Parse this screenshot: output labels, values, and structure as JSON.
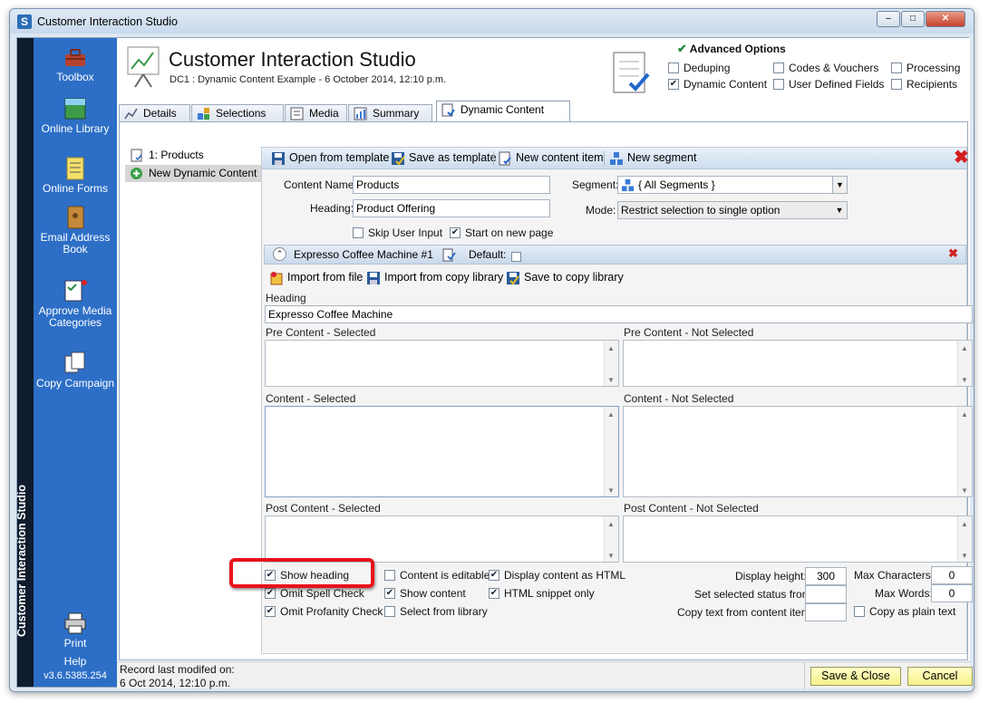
{
  "window": {
    "title": "Customer Interaction Studio",
    "minimize": "–",
    "maximize": "□",
    "close": "✕"
  },
  "sidebar": {
    "vertical_label": "Customer Interaction Studio",
    "items": [
      {
        "label": "Toolbox",
        "icon": "toolbox-icon"
      },
      {
        "label": "Online Library",
        "icon": "online-library-icon"
      },
      {
        "label": "Online Forms",
        "icon": "online-forms-icon"
      },
      {
        "label": "Email Address Book",
        "icon": "address-book-icon"
      },
      {
        "label": "Approve Media Categories",
        "icon": "approve-media-icon"
      },
      {
        "label": "Copy Campaign",
        "icon": "copy-campaign-icon"
      }
    ],
    "print_label": "Print",
    "help_label": "Help",
    "version": "v3.6.5385.254"
  },
  "header": {
    "title": "Customer Interaction Studio",
    "subtitle": "DC1 : Dynamic Content Example - 6 October 2014, 12:10 p.m."
  },
  "advanced": {
    "title": "Advanced Options",
    "options": [
      {
        "label": "Deduping",
        "checked": false
      },
      {
        "label": "Codes & Vouchers",
        "checked": false
      },
      {
        "label": "Processing",
        "checked": false
      },
      {
        "label": "Dynamic Content",
        "checked": true
      },
      {
        "label": "User Defined Fields",
        "checked": false
      },
      {
        "label": "Recipients",
        "checked": false
      }
    ]
  },
  "tabs": [
    {
      "label": "Details"
    },
    {
      "label": "Selections"
    },
    {
      "label": "Media"
    },
    {
      "label": "Summary"
    },
    {
      "label": "Dynamic Content"
    }
  ],
  "tree": {
    "items": [
      {
        "label": "1: Products"
      },
      {
        "label": "New Dynamic Content"
      }
    ]
  },
  "toolbar": {
    "open_template": "Open from template",
    "save_template": "Save as template",
    "new_content_item": "New content item",
    "new_segment": "New segment"
  },
  "form": {
    "content_name_label": "Content Name:",
    "content_name_value": "Products",
    "heading_label": "Heading:",
    "heading_value": "Product Offering",
    "segment_label": "Segment:",
    "segment_value": "{ All Segments }",
    "mode_label": "Mode:",
    "mode_value": "Restrict selection to single option",
    "skip_user_input": "Skip User Input",
    "skip_user_input_checked": false,
    "start_new_page": "Start on new page",
    "start_new_page_checked": true
  },
  "item": {
    "title": "Expresso Coffee Machine #1",
    "default_label": "Default:",
    "default_checked": false,
    "import_file": "Import from file",
    "import_copy": "Import from copy library",
    "save_copy": "Save to copy library",
    "heading_label": "Heading",
    "heading_value": "Expresso Coffee Machine",
    "pre_selected": "Pre Content - Selected",
    "pre_not_selected": "Pre Content - Not Selected",
    "content_selected": "Content - Selected",
    "content_not_selected": "Content - Not Selected",
    "post_selected": "Post Content - Selected",
    "post_not_selected": "Post Content - Not Selected"
  },
  "options": {
    "show_heading": "Show heading",
    "omit_spell": "Omit Spell Check",
    "omit_profanity": "Omit Profanity Check",
    "content_editable": "Content is editable",
    "show_content": "Show content",
    "select_from_library": "Select from library",
    "display_html": "Display content as HTML",
    "html_snippet": "HTML snippet only",
    "display_height_label": "Display height:",
    "display_height_value": "300",
    "set_status_label": "Set selected status from",
    "copy_text_label": "Copy text from content item:",
    "max_chars_label": "Max Characters:",
    "max_chars_value": "0",
    "max_words_label": "Max Words:",
    "max_words_value": "0",
    "copy_plain_text": "Copy as plain text"
  },
  "status": {
    "record_label": "Record last modifed on:",
    "record_value": "6 Oct 2014, 12:10 p.m."
  },
  "buttons": {
    "save_close": "Save & Close",
    "cancel": "Cancel"
  },
  "check_mark": "✔"
}
